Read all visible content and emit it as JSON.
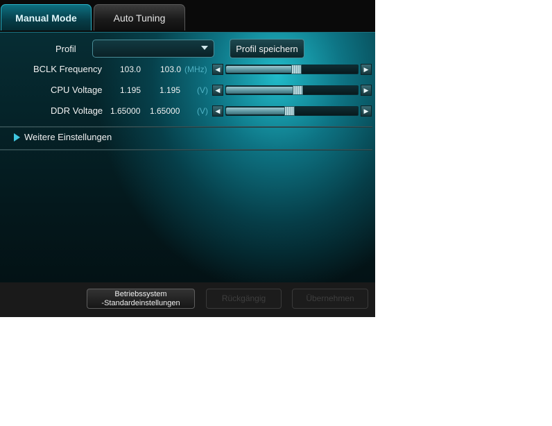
{
  "tabs": [
    {
      "label": "Manual Mode",
      "active": true
    },
    {
      "label": "Auto Tuning",
      "active": false
    }
  ],
  "profile": {
    "label": "Profil",
    "select_value": "",
    "save_label": "Profil speichern"
  },
  "settings": [
    {
      "label": "BCLK Frequency",
      "value": "103.0",
      "target": "103.0",
      "unit": "(MHz)",
      "level": 0.53
    },
    {
      "label": "CPU Voltage",
      "value": "1.195",
      "target": "1.195",
      "unit": "(V)",
      "level": 0.54
    },
    {
      "label": "DDR Voltage",
      "value": "1.65000",
      "target": "1.65000",
      "unit": "(V)",
      "level": 0.48
    }
  ],
  "more_settings_label": "Weitere Einstellungen",
  "footer": {
    "defaults_line1": "Betriebssystem",
    "defaults_line2": "-Standardeinstellungen",
    "undo_label": "Rückgängig",
    "save_label": "Übernehmen"
  },
  "colors": {
    "accent": "#2ab3c7",
    "unit_text": "#4fb2c4"
  }
}
